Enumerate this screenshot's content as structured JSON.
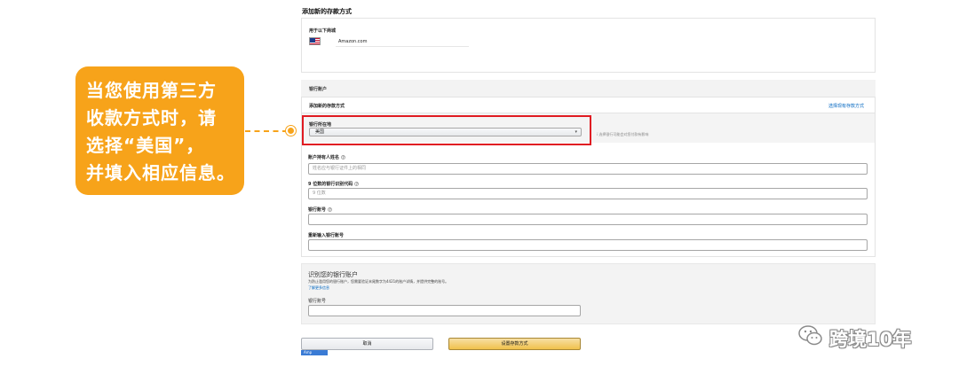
{
  "page": {
    "title": "添加新的存款方式"
  },
  "marketplace": {
    "label": "用于以下商城",
    "name": "Amazon.com",
    "flag_icon": "us-flag-icon"
  },
  "bank_section": {
    "header": "银行账户",
    "subheader": "添加新的存款方式",
    "select_existing_link": "选择现有存款方式",
    "country": {
      "label": "银行所在地",
      "selected": "美国",
      "hint": "i 选择银行可能会对您付款有影响"
    },
    "fields": [
      {
        "label": "账户持有人姓名",
        "placeholder": "姓名应与银行证件上的相同",
        "value": ""
      },
      {
        "label": "9 位数的银行识别代码",
        "placeholder": "9 位数",
        "value": ""
      },
      {
        "label": "银行账号",
        "placeholder": "",
        "value": ""
      },
      {
        "label": "重新输入银行账号",
        "placeholder": "",
        "value": ""
      }
    ]
  },
  "verify_section": {
    "title": "识别您的银行账户",
    "description": "为防止滥用您的银行账户，您需要验证末尾数字为4421的账户详情，并提供完整的账号。",
    "link": "了解更多信息",
    "field_label": "银行账号",
    "field_value": ""
  },
  "buttons": {
    "cancel": "取消",
    "submit": "设置存款方式"
  },
  "mini_tab": "Amp",
  "annotation": {
    "lines": [
      "当您使用第三方",
      "收款方式时，请",
      "选择“美国”，",
      "并填入相应信息。"
    ],
    "color": "#f7a31a",
    "highlight_color": "#e01b22"
  },
  "watermark": {
    "text": "跨境10年",
    "icon": "wechat-icon"
  }
}
